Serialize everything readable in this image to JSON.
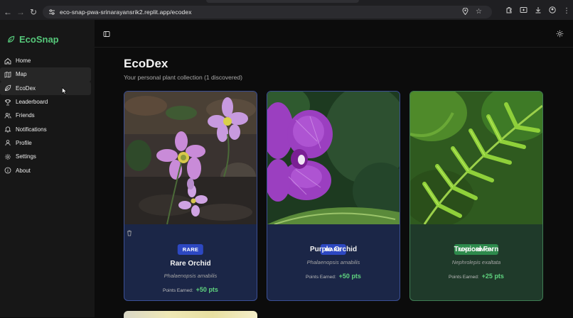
{
  "browser": {
    "url": "eco-snap-pwa-srinarayansrik2.replit.app/ecodex",
    "icons": [
      "back-icon",
      "forward-icon",
      "reload-icon",
      "site-settings-icon",
      "location-icon",
      "star-icon",
      "extensions-icon",
      "cast-icon",
      "download-icon",
      "account-icon",
      "more-icon"
    ]
  },
  "app": {
    "brand": "EcoSnap",
    "brand_color": "#56c87a"
  },
  "sidebar": {
    "items": [
      {
        "label": "Home",
        "icon": "home-icon"
      },
      {
        "label": "Map",
        "icon": "map-icon"
      },
      {
        "label": "EcoDex",
        "icon": "leaf-icon"
      },
      {
        "label": "Leaderboard",
        "icon": "trophy-icon"
      },
      {
        "label": "Friends",
        "icon": "users-icon"
      },
      {
        "label": "Notifications",
        "icon": "bell-icon"
      },
      {
        "label": "Profile",
        "icon": "user-icon"
      },
      {
        "label": "Settings",
        "icon": "gear-icon"
      },
      {
        "label": "About",
        "icon": "info-icon"
      }
    ]
  },
  "main": {
    "title": "EcoDex",
    "subtitle": "Your personal plant collection (1 discovered)",
    "cards": [
      {
        "rarity": "RARE",
        "name": "Rare Orchid",
        "scientific": "Phalaenopsis amabilis",
        "points_label": "Points Earned:",
        "points": "+50 pts",
        "color": "#2d48c2"
      },
      {
        "rarity": "RARE",
        "name": "Purple Orchid",
        "scientific": "Phalaenopsis amabilis",
        "points_label": "Points Earned:",
        "points": "+50 pts",
        "color": "#2d48c2"
      },
      {
        "rarity": "UNCOMMON",
        "name": "Tropical Fern",
        "scientific": "Nephrolepis exaltata",
        "points_label": "Points Earned:",
        "points": "+25 pts",
        "color": "#2e8a4c"
      }
    ]
  }
}
